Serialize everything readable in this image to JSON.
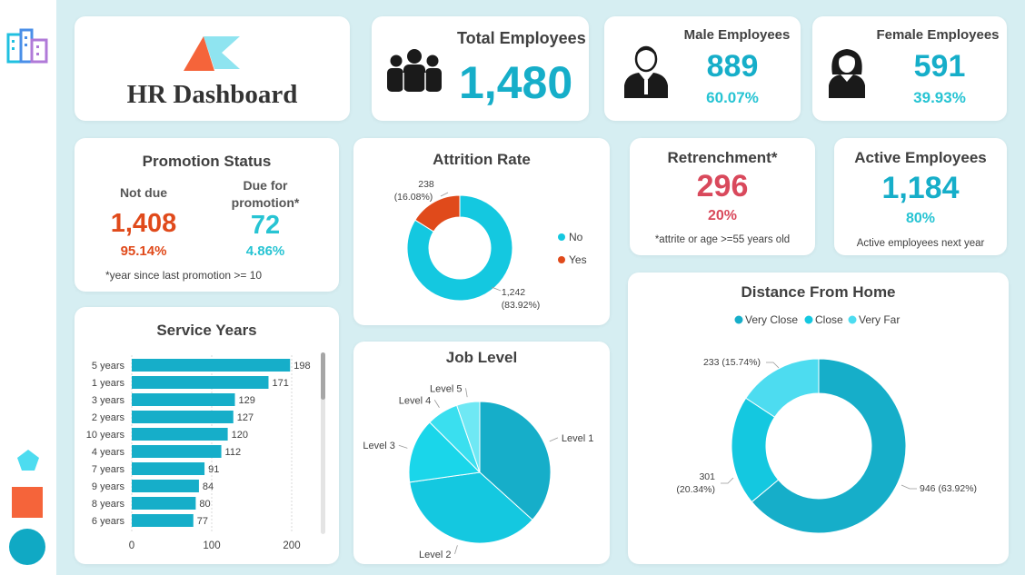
{
  "colors": {
    "teal": "#16aec9",
    "cyan": "#14c8e0",
    "light_cyan": "#4ddcf0",
    "orange": "#e04a1b",
    "red": "#d9495c",
    "background": "#d6eef2"
  },
  "sidebar": {
    "icons": [
      "building-icon",
      "pentagon-icon",
      "square-icon",
      "circle-icon"
    ]
  },
  "header": {
    "title": "HR Dashboard"
  },
  "total_employees": {
    "label": "Total Employees",
    "value": "1,480",
    "icon": "group-icon"
  },
  "male_employees": {
    "label": "Male Employees",
    "value": "889",
    "percent": "60.07%",
    "icon": "male-person-icon"
  },
  "female_employees": {
    "label": "Female Employees",
    "value": "591",
    "percent": "39.93%",
    "icon": "female-person-icon"
  },
  "promotion_status": {
    "title": "Promotion Status",
    "not_due": {
      "label": "Not due",
      "value": "1,408",
      "percent": "95.14%"
    },
    "due": {
      "label_line1": "Due for",
      "label_line2": "promotion*",
      "value": "72",
      "percent": "4.86%"
    },
    "note": "*year since last promotion >= 10"
  },
  "retrenchment": {
    "title": "Retrenchment*",
    "value": "296",
    "percent": "20%",
    "note": "*attrite or age >=55 years old"
  },
  "active_employees": {
    "title": "Active Employees",
    "value": "1,184",
    "percent": "80%",
    "note": "Active employees next year"
  },
  "chart_data": [
    {
      "type": "pie",
      "variant": "donut",
      "title": "Attrition Rate",
      "categories": [
        "No",
        "Yes"
      ],
      "values": [
        1242,
        238
      ],
      "labels": [
        [
          "1,242",
          "(83.92%)"
        ],
        [
          "238",
          "(16.08%)"
        ]
      ],
      "colors": [
        "#14c8e0",
        "#e04a1b"
      ],
      "legend": [
        "No",
        "Yes"
      ],
      "legend_position": "right"
    },
    {
      "type": "bar",
      "orientation": "horizontal",
      "title": "Service Years",
      "categories": [
        "5 years",
        "1 years",
        "3 years",
        "2 years",
        "10 years",
        "4 years",
        "7 years",
        "9 years",
        "8 years",
        "6 years"
      ],
      "values": [
        198,
        171,
        129,
        127,
        120,
        112,
        91,
        84,
        80,
        77
      ],
      "xticks": [
        0,
        100,
        200
      ],
      "xlim": [
        0,
        200
      ],
      "color": "#16aec9"
    },
    {
      "type": "pie",
      "title": "Job Level",
      "categories": [
        "Level 1",
        "Level 2",
        "Level 3",
        "Level 4",
        "Level 5"
      ],
      "values": [
        543,
        534,
        218,
        107,
        78
      ],
      "colors": [
        "#16aec9",
        "#14c8e0",
        "#1ad6ea",
        "#3adfef",
        "#6fe8f4"
      ]
    },
    {
      "type": "pie",
      "variant": "donut",
      "title": "Distance From Home",
      "categories": [
        "Very Close",
        "Close",
        "Very Far"
      ],
      "values": [
        946,
        301,
        233
      ],
      "labels": [
        [
          "946 (63.92%)"
        ],
        [
          "301",
          "(20.34%)"
        ],
        [
          "233 (15.74%)"
        ]
      ],
      "colors": [
        "#16aec9",
        "#14c8e0",
        "#4ddcf0"
      ],
      "legend": [
        "Very Close",
        "Close",
        "Very Far"
      ],
      "legend_position": "top"
    }
  ]
}
